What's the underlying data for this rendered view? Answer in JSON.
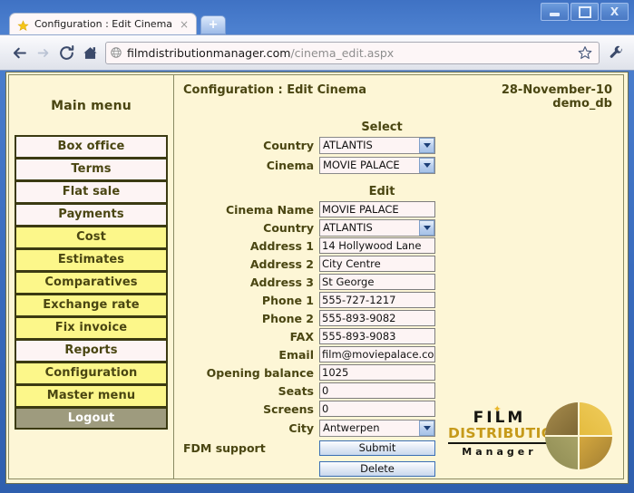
{
  "browser": {
    "tab": {
      "title": "Configuration : Edit Cinema",
      "favicon": "star-icon",
      "close": "×"
    },
    "new_tab_label": "+",
    "window_controls": {
      "minimize": "minimize-icon",
      "maximize": "maximize-icon",
      "close": "X"
    },
    "nav": {
      "back": "back-arrow-icon",
      "forward": "forward-arrow-icon",
      "reload": "reload-icon",
      "home": "home-icon",
      "bookmark": "star-outline-icon",
      "menu": "wrench-icon"
    },
    "url": {
      "domain": "filmdistributionmanager.com",
      "path": "/cinema_edit.aspx",
      "security_icon": "globe-icon"
    }
  },
  "sidebar": {
    "title": "Main menu",
    "items": [
      {
        "label": "Box office",
        "style": "white"
      },
      {
        "label": "Terms",
        "style": "white"
      },
      {
        "label": "Flat sale",
        "style": "white"
      },
      {
        "label": "Payments",
        "style": "white"
      },
      {
        "label": "Cost",
        "style": "yellow"
      },
      {
        "label": "Estimates",
        "style": "yellow"
      },
      {
        "label": "Comparatives",
        "style": "yellow"
      },
      {
        "label": "Exchange rate",
        "style": "yellow"
      },
      {
        "label": "Fix invoice",
        "style": "yellow"
      },
      {
        "label": "Reports",
        "style": "white"
      },
      {
        "label": "Configuration",
        "style": "yellow"
      },
      {
        "label": "Master menu",
        "style": "yellow"
      },
      {
        "label": "Logout",
        "style": "logout"
      }
    ]
  },
  "content": {
    "title": "Configuration : Edit Cinema",
    "date": "28-November-10",
    "database": "demo_db",
    "select_section": {
      "heading": "Select",
      "fields": [
        {
          "label": "Country",
          "value": "ATLANTIS",
          "type": "select"
        },
        {
          "label": "Cinema",
          "value": "MOVIE PALACE",
          "type": "select"
        }
      ]
    },
    "edit_section": {
      "heading": "Edit",
      "fields": [
        {
          "label": "Cinema Name",
          "value": "MOVIE PALACE",
          "type": "text"
        },
        {
          "label": "Country",
          "value": "ATLANTIS",
          "type": "select"
        },
        {
          "label": "Address 1",
          "value": "14 Hollywood Lane",
          "type": "text"
        },
        {
          "label": "Address 2",
          "value": "City Centre",
          "type": "text"
        },
        {
          "label": "Address 3",
          "value": "St George",
          "type": "text"
        },
        {
          "label": "Phone 1",
          "value": "555-727-1217",
          "type": "text"
        },
        {
          "label": "Phone 2",
          "value": "555-893-9082",
          "type": "text"
        },
        {
          "label": "FAX",
          "value": "555-893-9083",
          "type": "text"
        },
        {
          "label": "Email",
          "value": "film@moviepalace.com",
          "type": "text"
        },
        {
          "label": "Opening balance",
          "value": "1025",
          "type": "text"
        },
        {
          "label": "Seats",
          "value": "0",
          "type": "text"
        },
        {
          "label": "Screens",
          "value": "0",
          "type": "text"
        },
        {
          "label": "City",
          "value": "Antwerpen",
          "type": "select"
        }
      ]
    },
    "support_label": "FDM support",
    "buttons": [
      {
        "label": "Submit"
      },
      {
        "label": "Delete"
      }
    ],
    "logo": {
      "line1": "FILM",
      "line2": "DISTRIBUTION",
      "line3": "Manager",
      "star": "✦"
    }
  },
  "colors": {
    "page_bg": "#fdf6d6",
    "menu_yellow": "#fcf78a",
    "menu_white": "#fdf4f4",
    "logout_bg": "#9e9b7e",
    "text_olive": "#4a4612",
    "logo_gold": "#c69a1a",
    "chrome_blue": "#3a6cbe"
  }
}
